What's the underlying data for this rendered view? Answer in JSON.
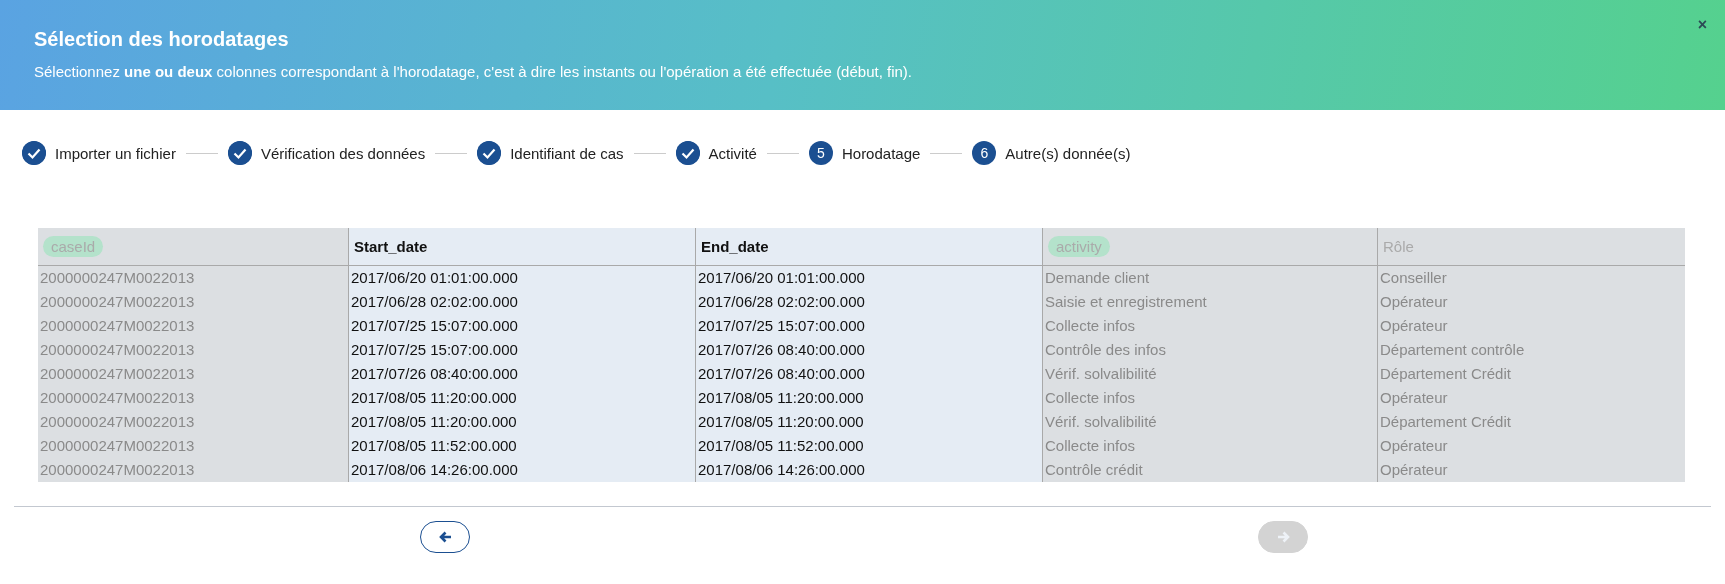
{
  "header": {
    "title": "Sélection des horodatages",
    "subtitle": "Sélectionnez **une ou deux** colonnes correspondant à l'horodatage, c'est à dire les instants ou l'opération a été effectuée (début, fin).",
    "close": "×"
  },
  "steps": [
    {
      "label": "Importer un fichier",
      "done": true
    },
    {
      "label": "Vérification des données",
      "done": true
    },
    {
      "label": "Identifiant de cas",
      "done": true
    },
    {
      "label": "Activité",
      "done": true
    },
    {
      "label": "Horodatage",
      "done": false,
      "number": "5"
    },
    {
      "label": "Autre(s) donnée(s)",
      "done": false,
      "number": "6"
    }
  ],
  "table": {
    "columns": [
      {
        "kind": "tag",
        "label": "caseId",
        "selected": false
      },
      {
        "kind": "plain",
        "label": "Start_date",
        "selected": true
      },
      {
        "kind": "plain",
        "label": "End_date",
        "selected": true
      },
      {
        "kind": "tag",
        "label": "activity",
        "selected": false
      },
      {
        "kind": "plain",
        "label": "Rôle",
        "selected": false
      }
    ],
    "rows": [
      [
        "2000000247M0022013",
        "2017/06/20 01:01:00.000",
        "2017/06/20 01:01:00.000",
        "Demande client",
        "Conseiller"
      ],
      [
        "2000000247M0022013",
        "2017/06/28 02:02:00.000",
        "2017/06/28 02:02:00.000",
        "Saisie et enregistrement",
        "Opérateur"
      ],
      [
        "2000000247M0022013",
        "2017/07/25 15:07:00.000",
        "2017/07/25 15:07:00.000",
        "Collecte infos",
        "Opérateur"
      ],
      [
        "2000000247M0022013",
        "2017/07/25 15:07:00.000",
        "2017/07/26 08:40:00.000",
        "Contrôle des infos",
        "Département contrôle"
      ],
      [
        "2000000247M0022013",
        "2017/07/26 08:40:00.000",
        "2017/07/26 08:40:00.000",
        "Vérif. solvalibilité",
        "Département Crédit"
      ],
      [
        "2000000247M0022013",
        "2017/08/05 11:20:00.000",
        "2017/08/05 11:20:00.000",
        "Collecte infos",
        "Opérateur"
      ],
      [
        "2000000247M0022013",
        "2017/08/05 11:20:00.000",
        "2017/08/05 11:20:00.000",
        "Vérif. solvalibilité",
        "Département Crédit"
      ],
      [
        "2000000247M0022013",
        "2017/08/05 11:52:00.000",
        "2017/08/05 11:52:00.000",
        "Collecte infos",
        "Opérateur"
      ],
      [
        "2000000247M0022013",
        "2017/08/06 14:26:00.000",
        "2017/08/06 14:26:00.000",
        "Contrôle crédit",
        "Opérateur"
      ]
    ]
  },
  "nav": {
    "back_disabled": false,
    "next_disabled": true
  }
}
